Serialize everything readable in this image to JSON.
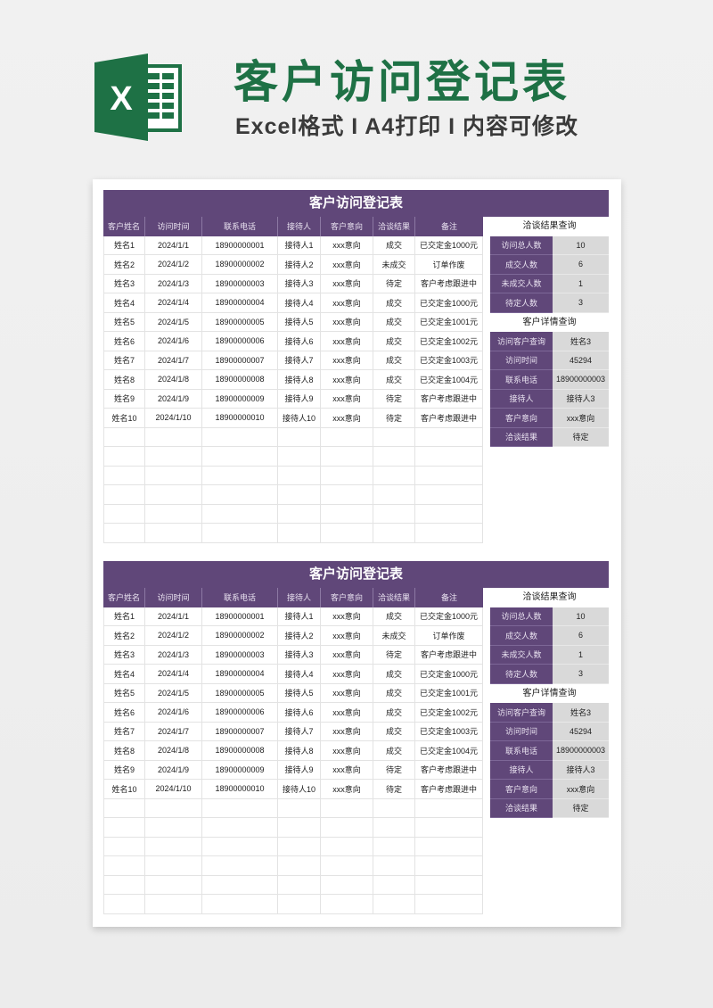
{
  "header": {
    "logo_letter": "X",
    "title": "客户访问登记表",
    "subtitle": "Excel格式 I A4打印 I 内容可修改"
  },
  "colors": {
    "brand_green": "#1e7145",
    "purple": "#604779",
    "value_gray": "#d9d9d9"
  },
  "sheets": [
    {
      "title": "客户访问登记表",
      "columns": [
        "客户姓名",
        "访问时间",
        "联系电话",
        "接待人",
        "客户意向",
        "洽谈结果",
        "备注"
      ],
      "rows": [
        [
          "姓名1",
          "2024/1/1",
          "18900000001",
          "接待人1",
          "xxx意向",
          "成交",
          "已交定金1000元"
        ],
        [
          "姓名2",
          "2024/1/2",
          "18900000002",
          "接待人2",
          "xxx意向",
          "未成交",
          "订单作废"
        ],
        [
          "姓名3",
          "2024/1/3",
          "18900000003",
          "接待人3",
          "xxx意向",
          "待定",
          "客户考虑跟进中"
        ],
        [
          "姓名4",
          "2024/1/4",
          "18900000004",
          "接待人4",
          "xxx意向",
          "成交",
          "已交定金1000元"
        ],
        [
          "姓名5",
          "2024/1/5",
          "18900000005",
          "接待人5",
          "xxx意向",
          "成交",
          "已交定金1001元"
        ],
        [
          "姓名6",
          "2024/1/6",
          "18900000006",
          "接待人6",
          "xxx意向",
          "成交",
          "已交定金1002元"
        ],
        [
          "姓名7",
          "2024/1/7",
          "18900000007",
          "接待人7",
          "xxx意向",
          "成交",
          "已交定金1003元"
        ],
        [
          "姓名8",
          "2024/1/8",
          "18900000008",
          "接待人8",
          "xxx意向",
          "成交",
          "已交定金1004元"
        ],
        [
          "姓名9",
          "2024/1/9",
          "18900000009",
          "接待人9",
          "xxx意向",
          "待定",
          "客户考虑跟进中"
        ],
        [
          "姓名10",
          "2024/1/10",
          "18900000010",
          "接待人10",
          "xxx意向",
          "待定",
          "客户考虑跟进中"
        ],
        [
          "",
          "",
          "",
          "",
          "",
          "",
          ""
        ],
        [
          "",
          "",
          "",
          "",
          "",
          "",
          ""
        ],
        [
          "",
          "",
          "",
          "",
          "",
          "",
          ""
        ],
        [
          "",
          "",
          "",
          "",
          "",
          "",
          ""
        ],
        [
          "",
          "",
          "",
          "",
          "",
          "",
          ""
        ],
        [
          "",
          "",
          "",
          "",
          "",
          "",
          ""
        ]
      ],
      "summary": {
        "title": "洽谈结果查询",
        "items": [
          {
            "label": "访问总人数",
            "value": "10"
          },
          {
            "label": "成交人数",
            "value": "6"
          },
          {
            "label": "未成交人数",
            "value": "1"
          },
          {
            "label": "待定人数",
            "value": "3"
          }
        ]
      },
      "detail": {
        "title": "客户详情查询",
        "items": [
          {
            "label": "访问客户查询",
            "value": "姓名3"
          },
          {
            "label": "访问时间",
            "value": "45294"
          },
          {
            "label": "联系电话",
            "value": "18900000003"
          },
          {
            "label": "接待人",
            "value": "接待人3"
          },
          {
            "label": "客户意向",
            "value": "xxx意向"
          },
          {
            "label": "洽谈结果",
            "value": "待定"
          }
        ]
      }
    },
    {
      "title": "客户访问登记表",
      "columns": [
        "客户姓名",
        "访问时间",
        "联系电话",
        "接待人",
        "客户意向",
        "洽谈结果",
        "备注"
      ],
      "rows": [
        [
          "姓名1",
          "2024/1/1",
          "18900000001",
          "接待人1",
          "xxx意向",
          "成交",
          "已交定金1000元"
        ],
        [
          "姓名2",
          "2024/1/2",
          "18900000002",
          "接待人2",
          "xxx意向",
          "未成交",
          "订单作废"
        ],
        [
          "姓名3",
          "2024/1/3",
          "18900000003",
          "接待人3",
          "xxx意向",
          "待定",
          "客户考虑跟进中"
        ],
        [
          "姓名4",
          "2024/1/4",
          "18900000004",
          "接待人4",
          "xxx意向",
          "成交",
          "已交定金1000元"
        ],
        [
          "姓名5",
          "2024/1/5",
          "18900000005",
          "接待人5",
          "xxx意向",
          "成交",
          "已交定金1001元"
        ],
        [
          "姓名6",
          "2024/1/6",
          "18900000006",
          "接待人6",
          "xxx意向",
          "成交",
          "已交定金1002元"
        ],
        [
          "姓名7",
          "2024/1/7",
          "18900000007",
          "接待人7",
          "xxx意向",
          "成交",
          "已交定金1003元"
        ],
        [
          "姓名8",
          "2024/1/8",
          "18900000008",
          "接待人8",
          "xxx意向",
          "成交",
          "已交定金1004元"
        ],
        [
          "姓名9",
          "2024/1/9",
          "18900000009",
          "接待人9",
          "xxx意向",
          "待定",
          "客户考虑跟进中"
        ],
        [
          "姓名10",
          "2024/1/10",
          "18900000010",
          "接待人10",
          "xxx意向",
          "待定",
          "客户考虑跟进中"
        ],
        [
          "",
          "",
          "",
          "",
          "",
          "",
          ""
        ],
        [
          "",
          "",
          "",
          "",
          "",
          "",
          ""
        ],
        [
          "",
          "",
          "",
          "",
          "",
          "",
          ""
        ],
        [
          "",
          "",
          "",
          "",
          "",
          "",
          ""
        ],
        [
          "",
          "",
          "",
          "",
          "",
          "",
          ""
        ],
        [
          "",
          "",
          "",
          "",
          "",
          "",
          ""
        ]
      ],
      "summary": {
        "title": "洽谈结果查询",
        "items": [
          {
            "label": "访问总人数",
            "value": "10"
          },
          {
            "label": "成交人数",
            "value": "6"
          },
          {
            "label": "未成交人数",
            "value": "1"
          },
          {
            "label": "待定人数",
            "value": "3"
          }
        ]
      },
      "detail": {
        "title": "客户详情查询",
        "items": [
          {
            "label": "访问客户查询",
            "value": "姓名3"
          },
          {
            "label": "访问时间",
            "value": "45294"
          },
          {
            "label": "联系电话",
            "value": "18900000003"
          },
          {
            "label": "接待人",
            "value": "接待人3"
          },
          {
            "label": "客户意向",
            "value": "xxx意向"
          },
          {
            "label": "洽谈结果",
            "value": "待定"
          }
        ]
      }
    }
  ]
}
